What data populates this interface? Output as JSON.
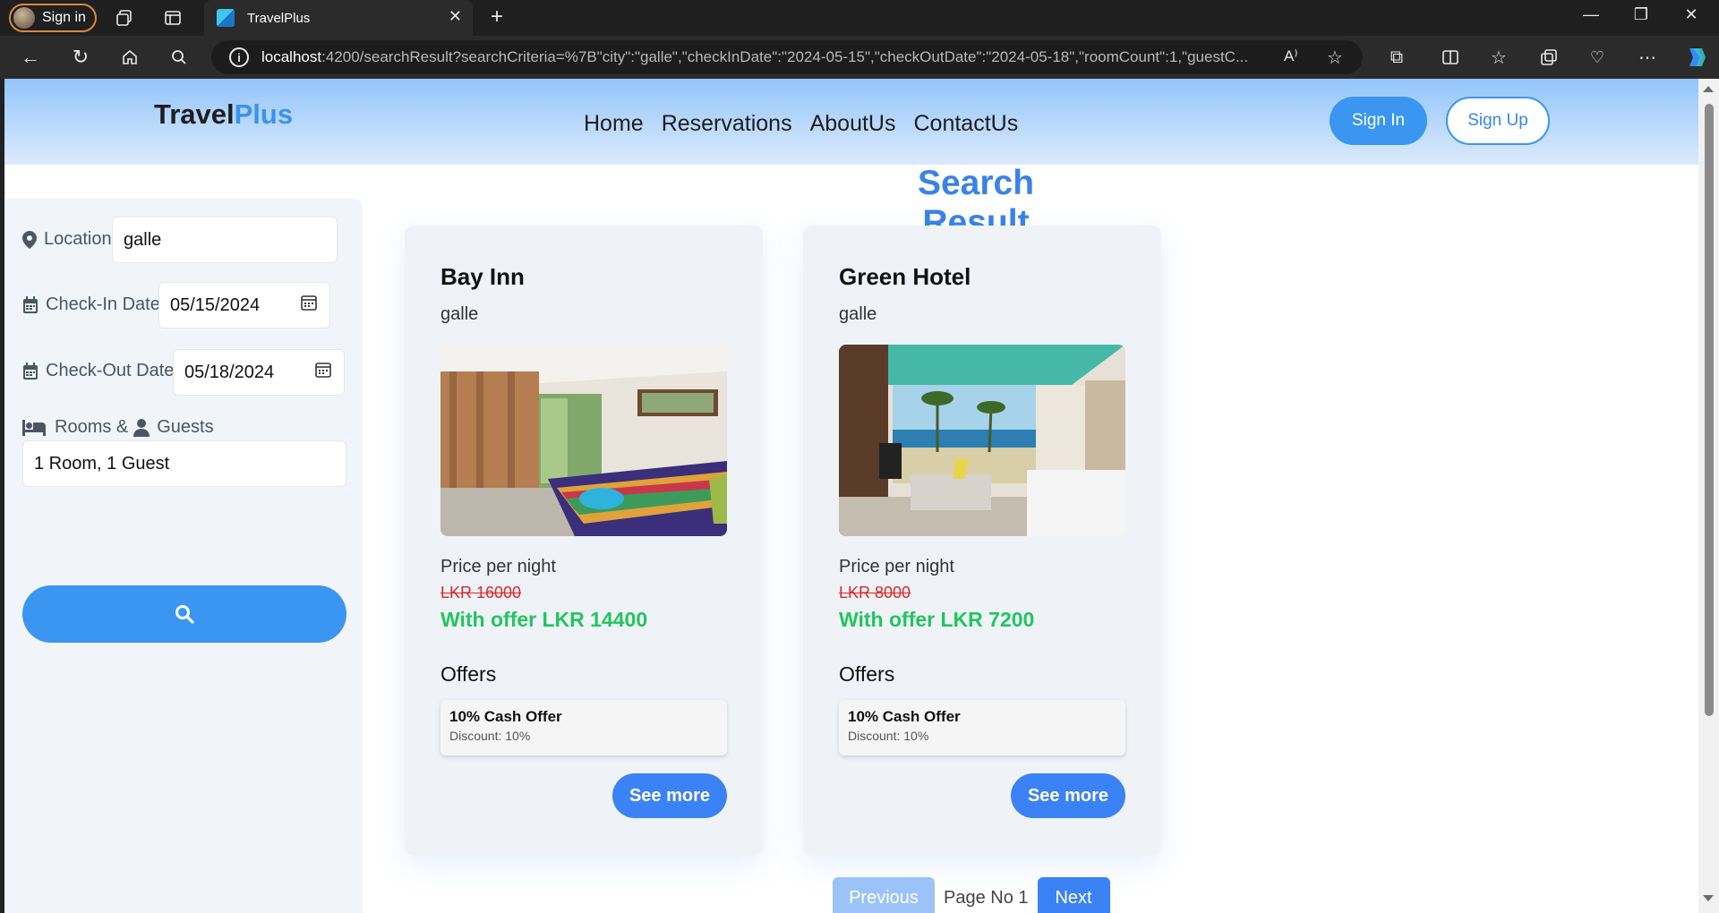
{
  "browser": {
    "profile_label": "Sign in",
    "tab_title": "TravelPlus",
    "url_host": "localhost",
    "url_rest": ":4200/searchResult?searchCriteria=%7B\"city\":\"galle\",\"checkInDate\":\"2024-05-15\",\"checkOutDate\":\"2024-05-18\",\"roomCount\":1,\"guestC..."
  },
  "nav": {
    "logo_main": "Travel",
    "logo_accent": "Plus",
    "links": [
      "Home",
      "Reservations",
      "AboutUs",
      "ContactUs"
    ],
    "signin_label": "Sign In",
    "signup_label": "Sign Up"
  },
  "page_title": "Search Result",
  "search": {
    "location_label": "Location",
    "location_value": "galle",
    "checkin_label": "Check-In Date",
    "checkin_value": "05/15/2024",
    "checkout_label": "Check-Out Date",
    "checkout_value": "05/18/2024",
    "rooms_label": "Rooms &",
    "guests_label": "Guests",
    "rooms_guests_value": "1 Room, 1 Guest"
  },
  "hotels": [
    {
      "name": "Bay Inn",
      "city": "galle",
      "price_label": "Price per night",
      "price_old": "LKR 16000",
      "price_offer": "With offer LKR 14400",
      "offers_title": "Offers",
      "offer_name": "10% Cash Offer",
      "offer_discount": "Discount: 10%",
      "see_more": "See more"
    },
    {
      "name": "Green Hotel",
      "city": "galle",
      "price_label": "Price per night",
      "price_old": "LKR 8000",
      "price_offer": "With offer LKR 7200",
      "offers_title": "Offers",
      "offer_name": "10% Cash Offer",
      "offer_discount": "Discount: 10%",
      "see_more": "See more"
    }
  ],
  "pagination": {
    "prev_label": "Previous",
    "page_label": "Page No 1",
    "next_label": "Next"
  },
  "colors": {
    "accent": "#3a96f0",
    "title": "#3b82e8",
    "offer_green": "#22c55e",
    "strike_red": "#dc2626"
  }
}
